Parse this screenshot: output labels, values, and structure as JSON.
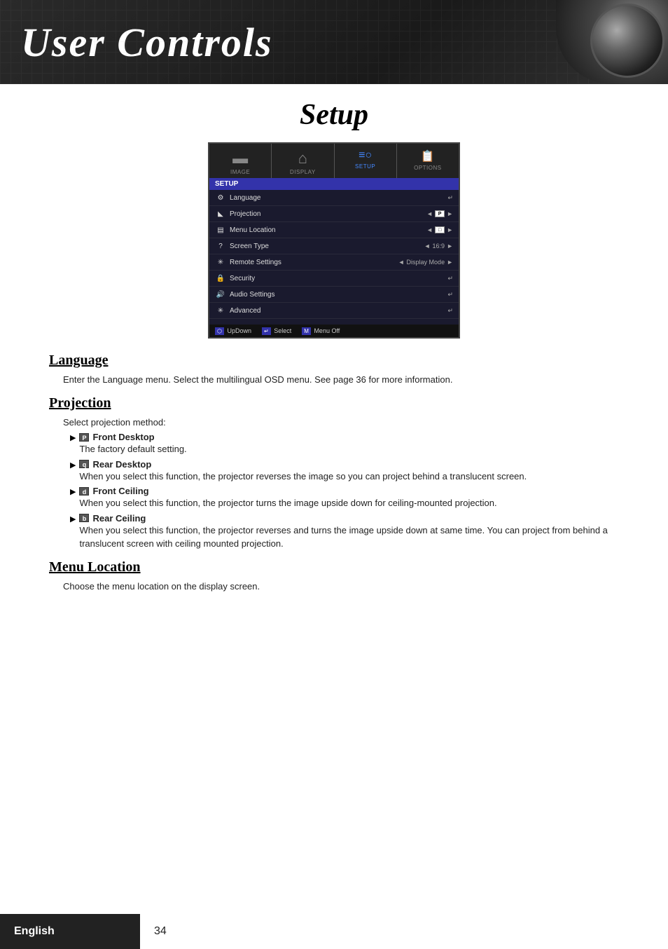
{
  "header": {
    "title": "User Controls"
  },
  "setup": {
    "title": "Setup"
  },
  "osd": {
    "tabs": [
      {
        "label": "IMAGE",
        "icon": "▬"
      },
      {
        "label": "DISPLAY",
        "icon": "⌂"
      },
      {
        "label": "SETUP",
        "icon": "≡○",
        "active": true
      },
      {
        "label": "OPTIONS",
        "icon": "📋"
      }
    ],
    "section": "SETUP",
    "rows": [
      {
        "icon": "⚙",
        "label": "Language",
        "value": "↵",
        "type": "enter"
      },
      {
        "icon": "◣",
        "label": "Projection",
        "value": "P",
        "arrows": true
      },
      {
        "icon": "▤",
        "label": "Menu Location",
        "value": "□",
        "arrows": true
      },
      {
        "icon": "?",
        "label": "Screen Type",
        "value": "16:9",
        "arrows": true
      },
      {
        "icon": "✳",
        "label": "Remote Settings",
        "value": "Display Mode",
        "arrows": true
      },
      {
        "icon": "🔒",
        "label": "Security",
        "value": "↵",
        "type": "enter"
      },
      {
        "icon": "🔊",
        "label": "Audio Settings",
        "value": "↵",
        "type": "enter"
      },
      {
        "icon": "✳",
        "label": "Advanced",
        "value": "↵",
        "type": "enter"
      }
    ],
    "footer": {
      "updown": "UpDown",
      "select": "Select",
      "menuoff": "Menu Off"
    }
  },
  "language": {
    "heading": "Language",
    "text": "Enter the Language menu. Select the multilingual OSD menu. See page 36 for more information."
  },
  "projection": {
    "heading": "Projection",
    "intro": "Select projection method:",
    "items": [
      {
        "badge": "P",
        "title": "Front Desktop",
        "desc": "The factory default setting."
      },
      {
        "badge": "q",
        "title": "Rear Desktop",
        "desc": "When you select this function, the projector reverses the image so you can project behind a translucent screen."
      },
      {
        "badge": "d",
        "title": "Front Ceiling",
        "desc": "When you select this function, the projector turns the image upside down for ceiling-mounted projection."
      },
      {
        "badge": "b",
        "title": "Rear Ceiling",
        "desc": "When you select this function, the projector reverses and turns the image upside down at same time. You can project from behind a translucent screen with ceiling mounted projection."
      }
    ]
  },
  "menu_location": {
    "heading": "Menu Location",
    "text": "Choose the menu location on the display screen."
  },
  "footer": {
    "language": "English",
    "page": "34"
  }
}
